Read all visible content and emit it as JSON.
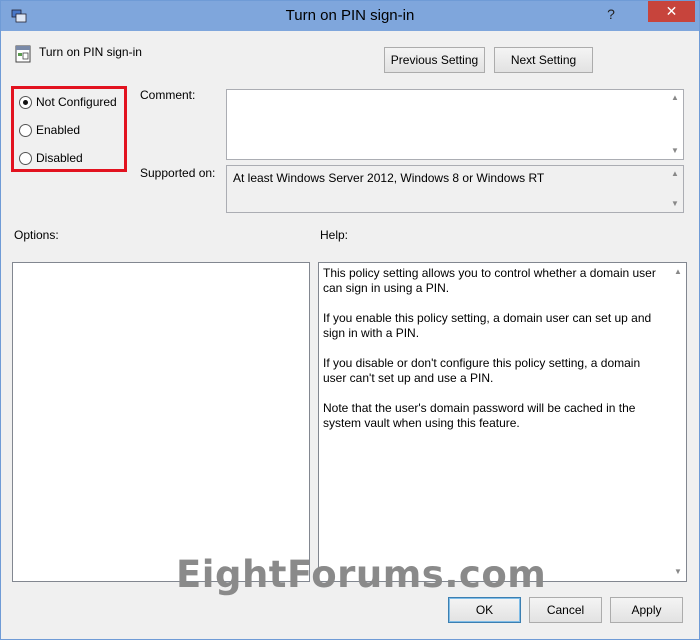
{
  "window": {
    "title": "Turn on PIN sign-in",
    "help_glyph": "?",
    "close_glyph": "✕"
  },
  "setting": {
    "name": "Turn on PIN sign-in"
  },
  "nav": {
    "previous_label": "Previous Setting",
    "next_label": "Next Setting"
  },
  "state_options": [
    {
      "label": "Not Configured",
      "checked": true
    },
    {
      "label": "Enabled",
      "checked": false
    },
    {
      "label": "Disabled",
      "checked": false
    }
  ],
  "comment": {
    "label": "Comment:",
    "value": ""
  },
  "supported": {
    "label": "Supported on:",
    "value": "At least Windows Server 2012, Windows 8 or Windows RT"
  },
  "options": {
    "label": "Options:"
  },
  "help": {
    "label": "Help:",
    "paragraphs": [
      "This policy setting allows you to control whether a domain user can sign in using a PIN.",
      "If you enable this policy setting, a domain user can set up and sign in with a PIN.",
      "If you disable or don't configure this policy setting, a domain user can't set up and use a PIN.",
      "Note that the user's domain password will be cached in the system vault when using this feature."
    ]
  },
  "footer": {
    "ok_label": "OK",
    "cancel_label": "Cancel",
    "apply_label": "Apply"
  },
  "watermark": {
    "text": "EightForums.com"
  },
  "colors": {
    "titlebar": "#7fa6dc",
    "close": "#c7443c",
    "highlight_box": "#e2121f"
  }
}
